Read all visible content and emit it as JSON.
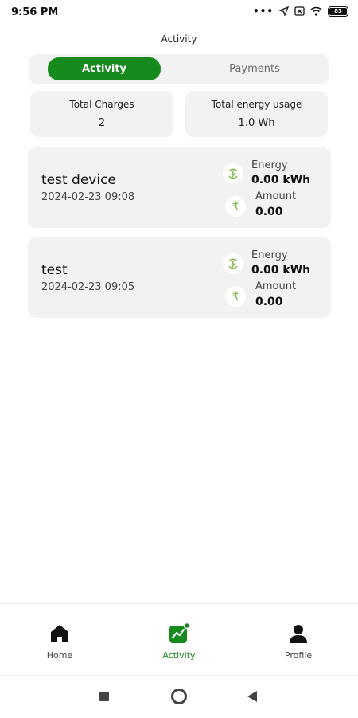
{
  "status_bar": {
    "time": "9:56 PM",
    "battery": "83"
  },
  "page_title": "Activity",
  "tabs": [
    {
      "label": "Activity",
      "active": true
    },
    {
      "label": "Payments",
      "active": false
    }
  ],
  "stats": [
    {
      "label": "Total Charges",
      "value": "2"
    },
    {
      "label": "Total energy usage",
      "value": "1.0 Wh"
    }
  ],
  "activities": [
    {
      "device": "test device",
      "datetime": "2024-02-23 09:08",
      "energy_label": "Energy",
      "energy_value": "0.00 kWh",
      "amount_label": "Amount",
      "amount_value": "0.00"
    },
    {
      "device": "test",
      "datetime": "2024-02-23 09:05",
      "energy_label": "Energy",
      "energy_value": "0.00 kWh",
      "amount_label": "Amount",
      "amount_value": "0.00"
    }
  ],
  "bottom_nav": [
    {
      "label": "Home",
      "icon": "home-icon",
      "active": false
    },
    {
      "label": "Activity",
      "icon": "activity-chart-icon",
      "active": true
    },
    {
      "label": "Profile",
      "icon": "profile-icon",
      "active": false
    }
  ],
  "colors": {
    "accent": "#168a1c",
    "card_bg": "#f2f2f2",
    "icon_green": "#7cb342"
  }
}
